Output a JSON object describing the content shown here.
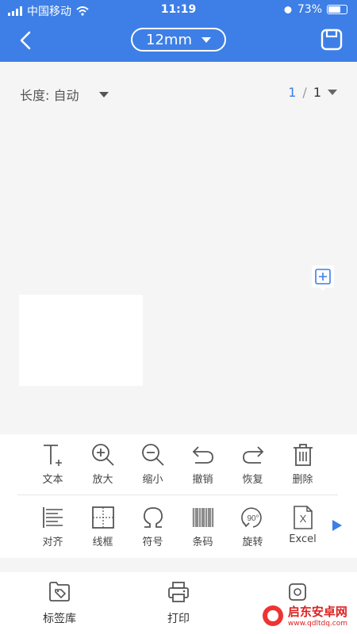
{
  "status_bar": {
    "carrier": "中国移动",
    "time": "11:19",
    "battery": "73%",
    "battery_level": 0.73
  },
  "header": {
    "tape_size": "12mm"
  },
  "canvas": {
    "length_label": "长度: 自动",
    "page_current": "1",
    "page_separator": "/",
    "page_total": "1"
  },
  "toolbar": {
    "row1": [
      {
        "label": "文本",
        "icon": "text-icon"
      },
      {
        "label": "放大",
        "icon": "zoom-in-icon"
      },
      {
        "label": "缩小",
        "icon": "zoom-out-icon"
      },
      {
        "label": "撤销",
        "icon": "undo-icon"
      },
      {
        "label": "恢复",
        "icon": "redo-icon"
      },
      {
        "label": "删除",
        "icon": "trash-icon"
      }
    ],
    "row2": [
      {
        "label": "对齐",
        "icon": "align-icon"
      },
      {
        "label": "线框",
        "icon": "frame-icon"
      },
      {
        "label": "符号",
        "icon": "omega-icon"
      },
      {
        "label": "条码",
        "icon": "barcode-icon"
      },
      {
        "label": "旋转",
        "icon": "rotate-icon",
        "glyph": "90°"
      },
      {
        "label": "Excel",
        "icon": "excel-icon",
        "glyph": "X"
      }
    ]
  },
  "bottom_nav": [
    {
      "label": "标签库",
      "icon": "tag-library-icon"
    },
    {
      "label": "打印",
      "icon": "printer-icon"
    },
    {
      "label": "",
      "icon": "settings-icon"
    }
  ],
  "watermark": {
    "title": "启东安卓网",
    "url": "www.qdltdq.com"
  },
  "colors": {
    "accent": "#3d7fe6",
    "background": "#f5f5f5"
  }
}
